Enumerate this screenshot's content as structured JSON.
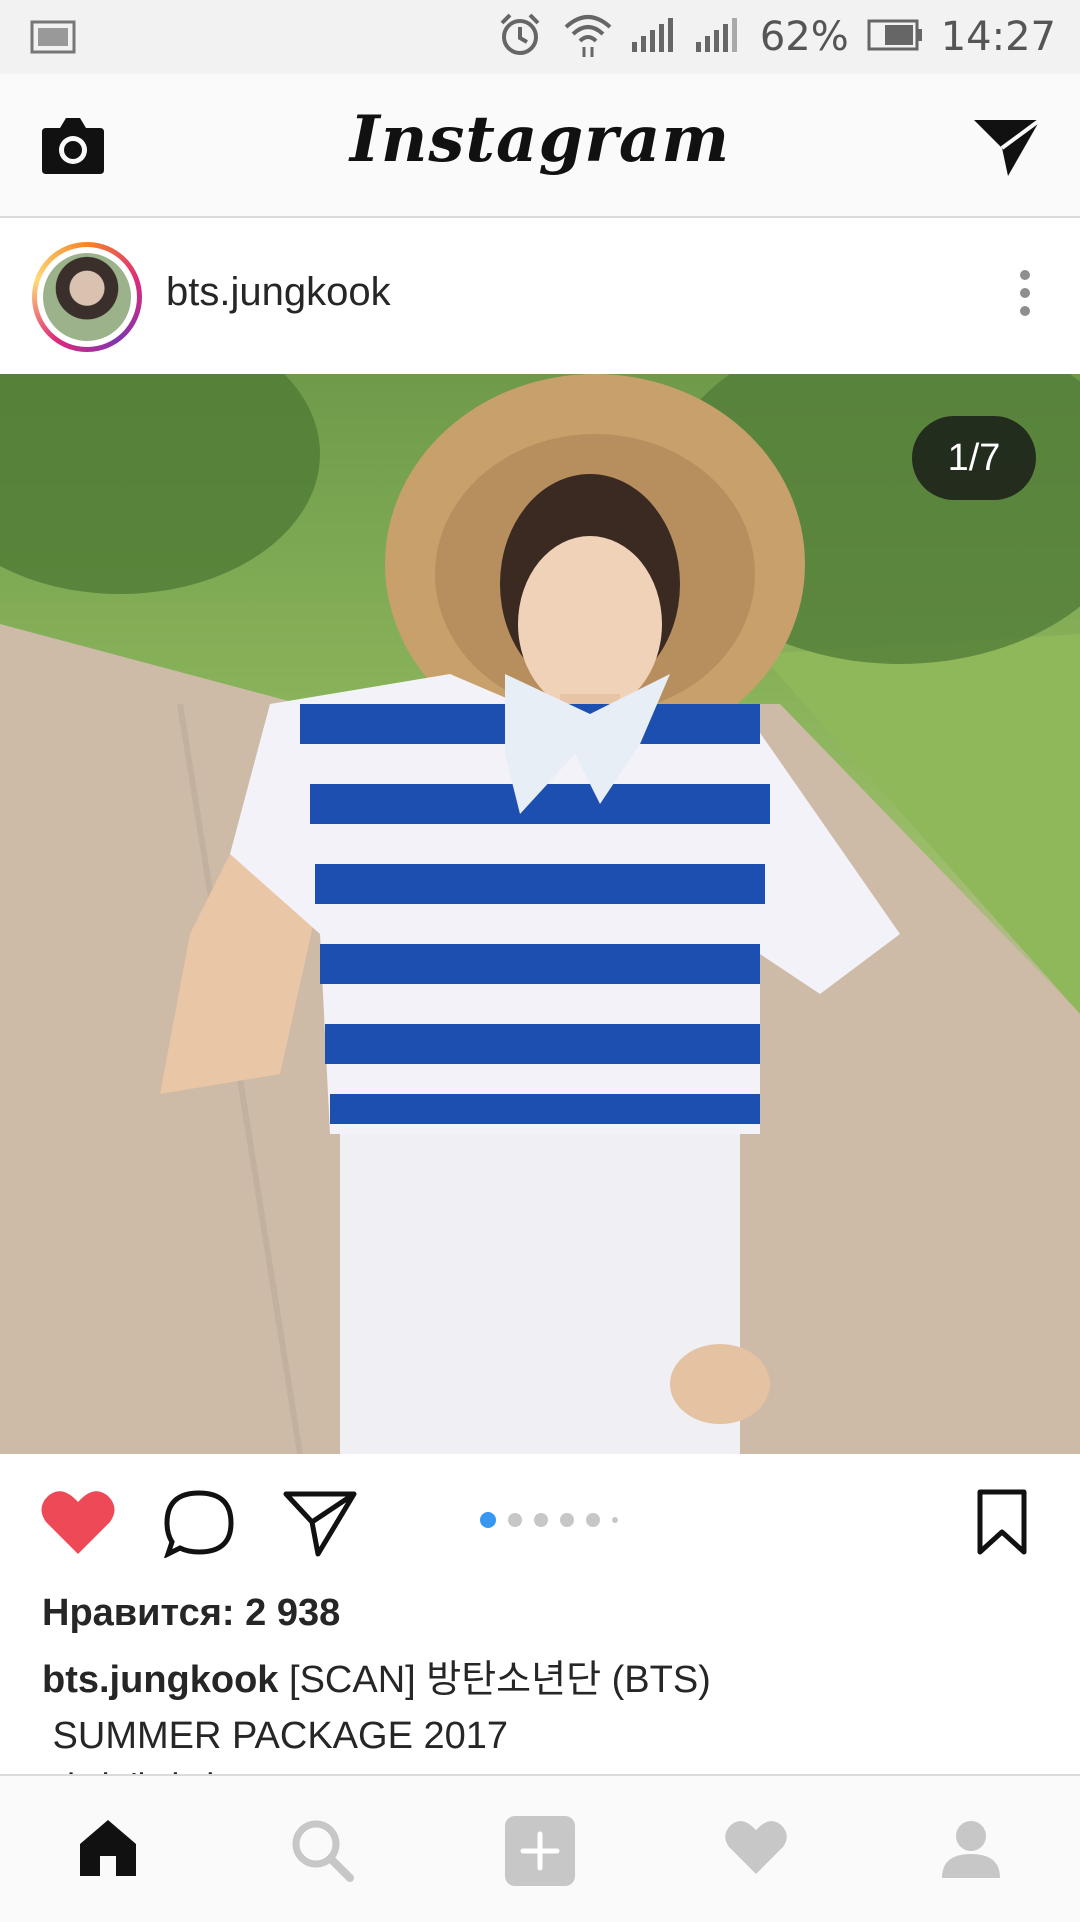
{
  "status_bar": {
    "battery_percent": "62%",
    "time": "14:27",
    "icons": [
      "gallery-notification-icon",
      "alarm-icon",
      "wifi-icon",
      "signal-icon",
      "signal-icon",
      "battery-icon"
    ]
  },
  "app_bar": {
    "title": "Instagram",
    "left_icon": "camera-icon",
    "right_icon": "direct-message-icon"
  },
  "post": {
    "username": "bts.jungkook",
    "image_counter": "1/7",
    "likes": "Нравится: 2 938",
    "caption_user": "bts.jungkook",
    "caption_line1": "[SCAN] 방탄소년단 (BTS)",
    "caption_line2": " SUMMER PACKAGE 2017",
    "caption_line3": "썸머패키지"
  },
  "actions": {
    "icons": [
      "heart-filled-icon",
      "comment-icon",
      "share-icon",
      "bookmark-icon"
    ],
    "carousel_pages": 6,
    "carousel_active": 1
  },
  "bottom_nav": {
    "items": [
      "home-icon",
      "search-icon",
      "add-icon",
      "activity-heart-icon",
      "profile-icon"
    ]
  },
  "colors": {
    "like_red": "#ed4956",
    "active_dot": "#3897f0",
    "text": "#262626",
    "icon_gray": "#c7c7c7"
  }
}
